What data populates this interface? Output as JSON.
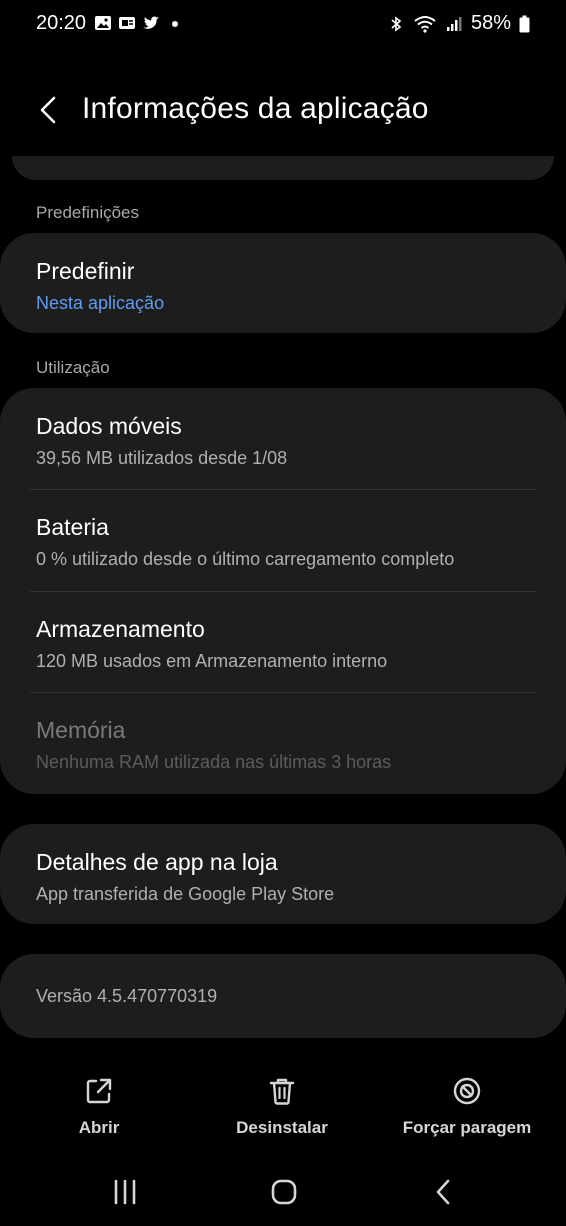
{
  "status_bar": {
    "time": "20:20",
    "battery": "58%",
    "left_icons": [
      "gallery-icon",
      "sim-icon",
      "twitter-icon",
      "dot-icon"
    ],
    "right_icons": [
      "bluetooth-icon",
      "wifi-icon",
      "signal-icon",
      "battery-icon"
    ]
  },
  "header": {
    "title": "Informações da aplicação"
  },
  "defaults": {
    "section_label": "Predefinições",
    "title": "Predefinir",
    "subtitle": "Nesta aplicação"
  },
  "usage": {
    "section_label": "Utilização",
    "items": [
      {
        "title": "Dados móveis",
        "subtitle": "39,56 MB utilizados desde 1/08"
      },
      {
        "title": "Bateria",
        "subtitle": "0 % utilizado desde o último carregamento completo"
      },
      {
        "title": "Armazenamento",
        "subtitle": "120 MB usados em Armazenamento interno"
      },
      {
        "title": "Memória",
        "subtitle": "Nenhuma RAM utilizada nas últimas 3 horas"
      }
    ]
  },
  "store": {
    "title": "Detalhes de app na loja",
    "subtitle": "App transferida de Google Play Store"
  },
  "version": {
    "text": "Versão 4.5.470770319"
  },
  "actions": [
    {
      "label": "Abrir",
      "icon": "open-external-icon"
    },
    {
      "label": "Desinstalar",
      "icon": "trash-icon"
    },
    {
      "label": "Forçar paragem",
      "icon": "force-stop-icon"
    }
  ],
  "nav": [
    "recents-icon",
    "home-icon",
    "back-icon"
  ]
}
